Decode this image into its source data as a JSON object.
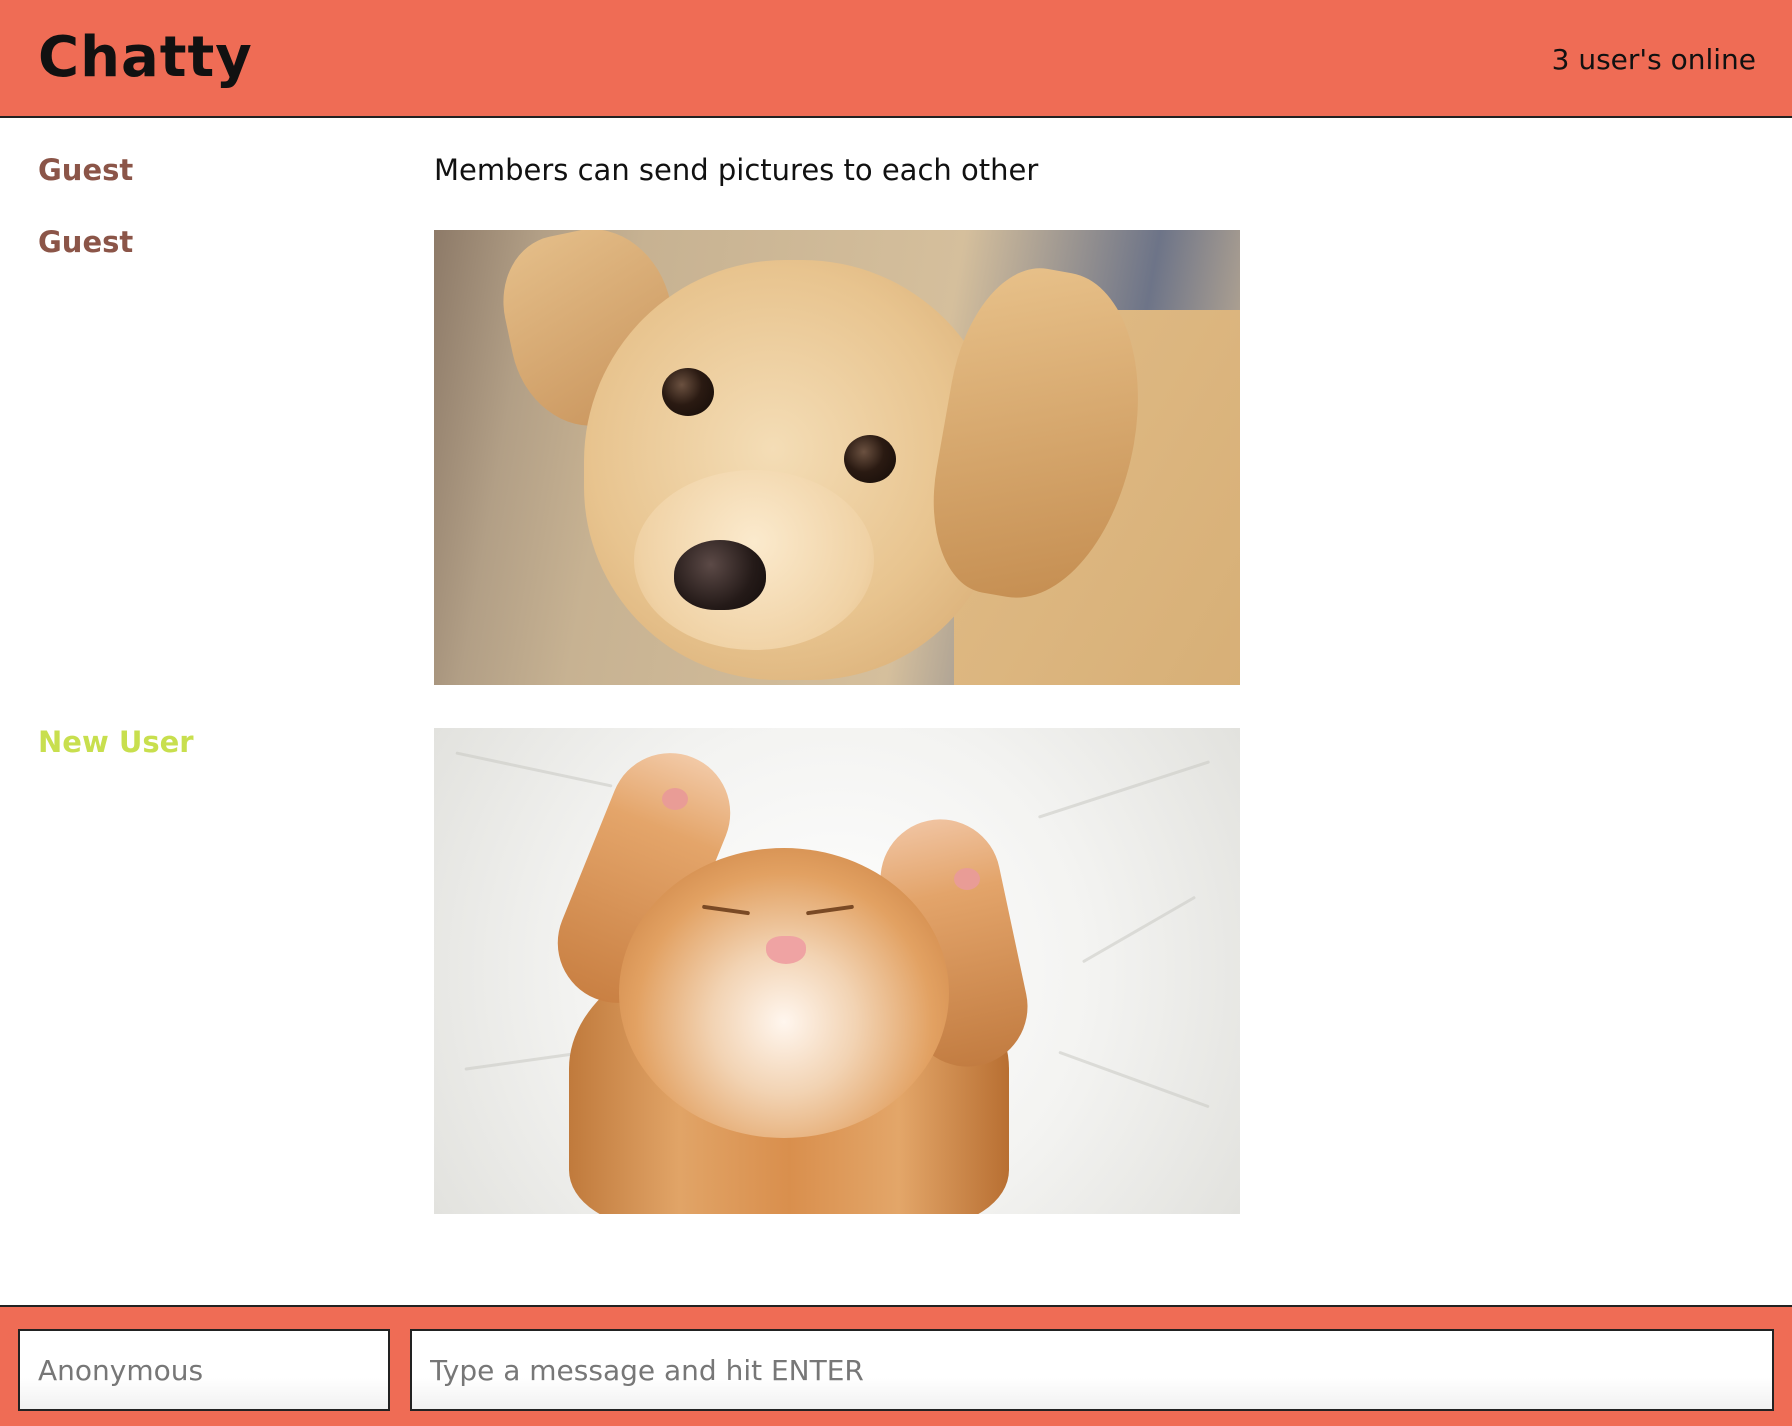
{
  "header": {
    "brand": "Chatty",
    "online_count": "3 user's online"
  },
  "messages": [
    {
      "username": "Guest",
      "username_color": "#8b5548",
      "content": "Members can send pictures to each other"
    },
    {
      "username": "Guest",
      "username_color": "#8b5548",
      "image": "puppy"
    },
    {
      "username": "New User",
      "username_color": "#c8df4e",
      "image": "kitten"
    }
  ],
  "chatbar": {
    "username_placeholder": "Anonymous",
    "message_placeholder": "Type a message and hit ENTER"
  },
  "colors": {
    "accent": "#ef6c55",
    "guest": "#8b5548",
    "new_user": "#c8df4e"
  }
}
